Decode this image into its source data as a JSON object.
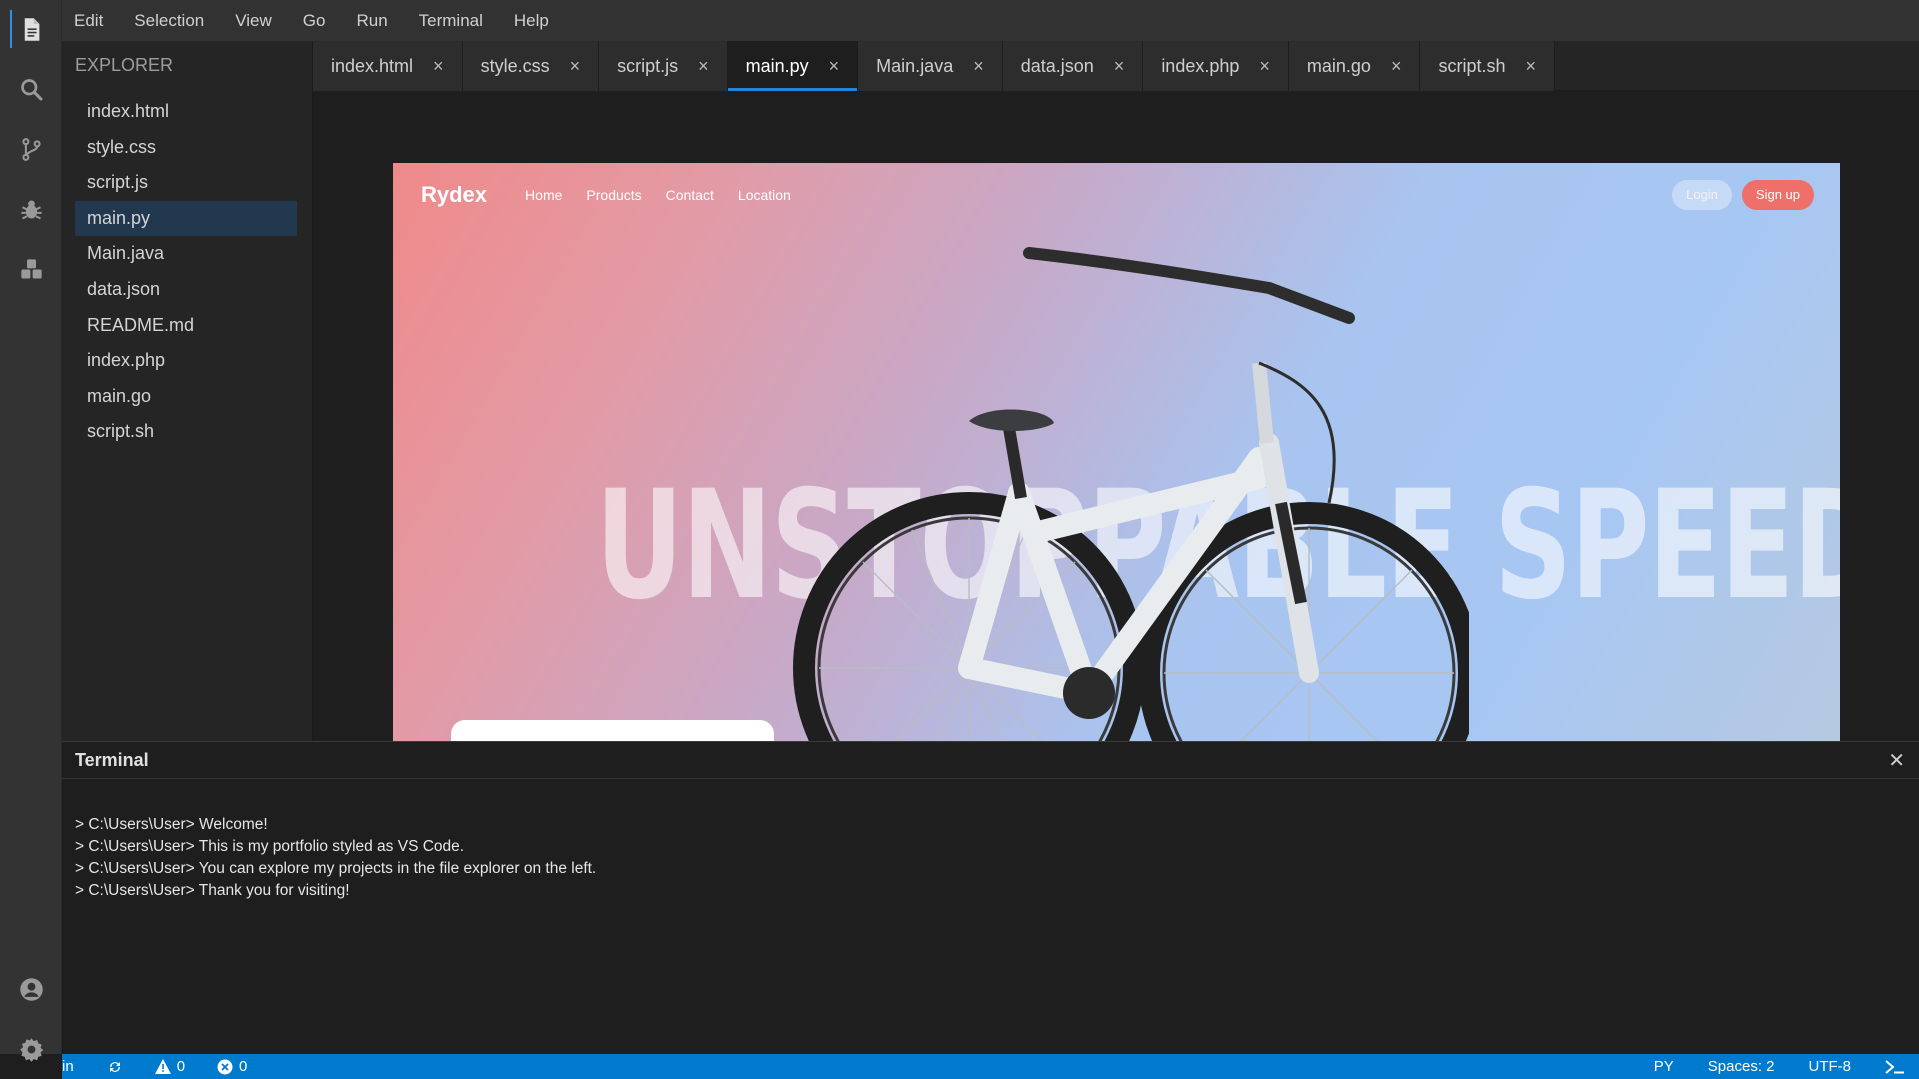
{
  "menu": [
    "Edit",
    "Selection",
    "View",
    "Go",
    "Run",
    "Terminal",
    "Help"
  ],
  "activity_bar": {
    "top_icons": [
      "files-icon",
      "search-icon",
      "source-control-icon",
      "debug-icon",
      "extensions-icon"
    ],
    "bottom_icons": [
      "account-icon",
      "settings-gear-icon"
    ]
  },
  "sidebar": {
    "title": "EXPLORER",
    "files": [
      "index.html",
      "style.css",
      "script.js",
      "main.py",
      "Main.java",
      "data.json",
      "README.md",
      "index.php",
      "main.go",
      "script.sh"
    ],
    "active_file": "main.py"
  },
  "tabs": [
    "index.html",
    "style.css",
    "script.js",
    "main.py",
    "Main.java",
    "data.json",
    "index.php",
    "main.go",
    "script.sh"
  ],
  "active_tab": "main.py",
  "tab_close_glyph": "×",
  "preview": {
    "logo": "Rydex",
    "nav_links": [
      "Home",
      "Products",
      "Contact",
      "Location"
    ],
    "login_label": "Login",
    "signup_label": "Sign up",
    "headline": "UNSTOPPABLE SPEED"
  },
  "terminal": {
    "title": "Terminal",
    "close_glyph": "✕",
    "lines": [
      "> C:\\Users\\User> Welcome!",
      "> C:\\Users\\User> This is my portfolio styled as VS Code.",
      "> C:\\Users\\User> You can explore my projects in the file explorer on the left.",
      "> C:\\Users\\User> Thank you for visiting!"
    ]
  },
  "status_bar": {
    "branch_fragment": "in",
    "warnings": "0",
    "errors": "0",
    "language": "PY",
    "spaces": "Spaces: 2",
    "encoding": "UTF-8"
  },
  "colors": {
    "accent": "#007acc",
    "active_tab_underline": "#1f86df",
    "active_file_bg": "#21384f",
    "signup_button": "#ef6f6a"
  }
}
